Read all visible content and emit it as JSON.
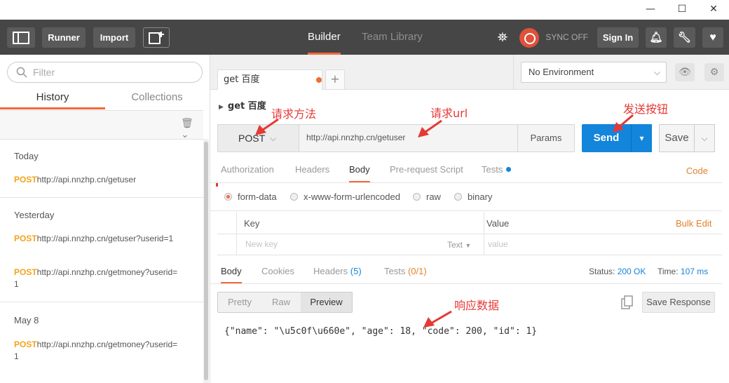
{
  "window": {
    "minimize": "—",
    "maximize": "☐",
    "close": "✕"
  },
  "header": {
    "runner_label": "Runner",
    "import_label": "Import",
    "tabs": [
      {
        "label": "Builder"
      },
      {
        "label": "Team Library"
      }
    ],
    "sync_label": "SYNC OFF",
    "signin_label": "Sign In",
    "accent_color": "#f26b3a"
  },
  "sidebar": {
    "filter_placeholder": "Filter",
    "tabs": [
      {
        "label": "History"
      },
      {
        "label": "Collections"
      }
    ],
    "groups": [
      {
        "label": "Today",
        "items": [
          {
            "method": "POST",
            "url": "http://api.nnzhp.cn/getuser"
          }
        ]
      },
      {
        "label": "Yesterday",
        "items": [
          {
            "method": "POST",
            "url": "http://api.nnzhp.cn/getuser?userid=1"
          },
          {
            "method": "POST",
            "url": "http://api.nnzhp.cn/getmoney?userid=1"
          }
        ]
      },
      {
        "label": "May 8",
        "items": [
          {
            "method": "POST",
            "url": "http://api.nnzhp.cn/getmoney?userid=1"
          }
        ]
      }
    ]
  },
  "request": {
    "tab_label": "get 百度",
    "name": "get 百度",
    "method": "POST",
    "url": "http://api.nnzhp.cn/getuser",
    "params_label": "Params",
    "send_label": "Send",
    "save_label": "Save",
    "environment": "No Environment",
    "subtabs": [
      {
        "label": "Authorization"
      },
      {
        "label": "Headers"
      },
      {
        "label": "Body"
      },
      {
        "label": "Pre-request Script"
      },
      {
        "label": "Tests"
      }
    ],
    "code_label": "Code",
    "body_types": [
      {
        "label": "form-data",
        "selected": true
      },
      {
        "label": "x-www-form-urlencoded",
        "selected": false
      },
      {
        "label": "raw",
        "selected": false
      },
      {
        "label": "binary",
        "selected": false
      }
    ],
    "kv": {
      "key_header": "Key",
      "value_header": "Value",
      "bulk_edit": "Bulk Edit",
      "key_placeholder": "New key",
      "type": "Text",
      "value_placeholder": "value"
    }
  },
  "response": {
    "tabs": [
      {
        "label": "Body",
        "count": ""
      },
      {
        "label": "Cookies",
        "count": ""
      },
      {
        "label": "Headers",
        "count": "(5)"
      },
      {
        "label": "Tests",
        "count": "(0/1)"
      }
    ],
    "status_label": "Status:",
    "status_value": "200 OK",
    "time_label": "Time:",
    "time_value": "107 ms",
    "views": [
      {
        "label": "Pretty"
      },
      {
        "label": "Raw"
      },
      {
        "label": "Preview"
      }
    ],
    "save_response_label": "Save Response",
    "body": "{\"name\": \"\\u5c0f\\u660e\", \"age\": 18, \"code\": 200, \"id\": 1}"
  },
  "annotations": {
    "method": "请求方法",
    "url": "请求url",
    "send": "发送按钮",
    "response": "响应数据",
    "color": "#e53935"
  }
}
